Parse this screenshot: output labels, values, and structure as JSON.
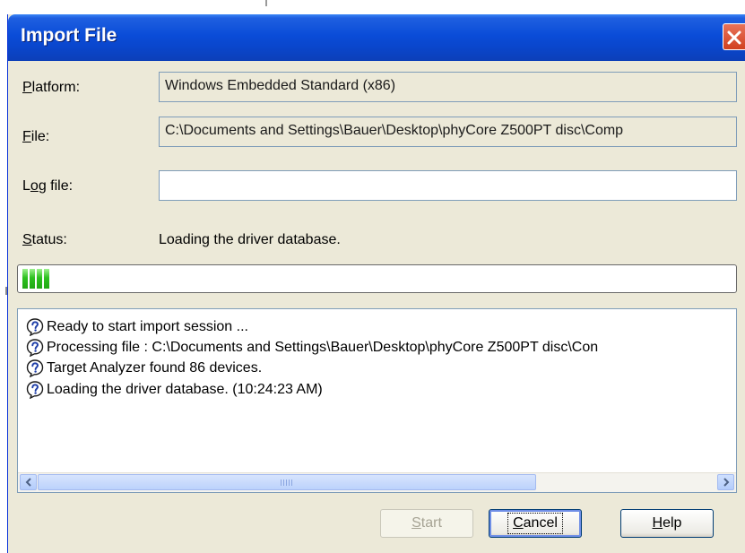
{
  "window": {
    "title": "Import File"
  },
  "form": {
    "platform": {
      "label_mnemonic": "P",
      "label_rest": "latform:",
      "value": "Windows Embedded Standard (x86)"
    },
    "file": {
      "label_mnemonic": "F",
      "label_rest": "ile:",
      "value": "C:\\Documents and Settings\\Bauer\\Desktop\\phyCore Z500PT disc\\Comp"
    },
    "log_file": {
      "label_pre": "L",
      "label_mnemonic": "o",
      "label_rest": "g file:",
      "value": ""
    },
    "status": {
      "label_mnemonic": "S",
      "label_rest": "tatus:",
      "value": "Loading the driver database."
    }
  },
  "progress": {
    "fraction": 0.04
  },
  "log": {
    "icon": "question-help-icon",
    "lines": [
      "Ready to start import session ...",
      "Processing file : C:\\Documents and Settings\\Bauer\\Desktop\\phyCore Z500PT disc\\Con",
      "Target Analyzer found 86 devices.",
      "Loading the driver database. (10:24:23 AM)"
    ]
  },
  "buttons": {
    "start": {
      "label": "Start",
      "mnemonic": "S",
      "rest": "tart",
      "enabled": false
    },
    "cancel": {
      "label": "Cancel",
      "mnemonic": "C",
      "rest": "ancel"
    },
    "help": {
      "label": "Help",
      "mnemonic": "H",
      "rest": "elp"
    }
  },
  "colors": {
    "titlebar": "#0a4cd8",
    "dialog_bg": "#ece9d8",
    "progress_fill": "#2dc01f",
    "close_button": "#d1401f"
  }
}
